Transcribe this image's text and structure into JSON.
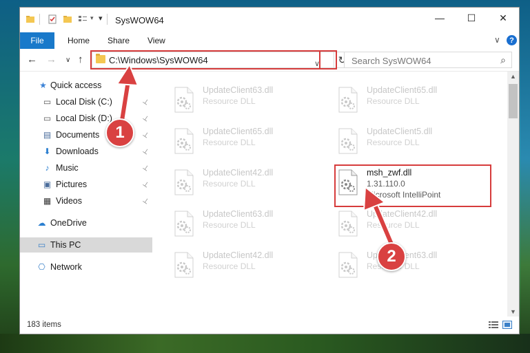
{
  "window": {
    "title": "SysWOW64",
    "minimize_glyph": "—",
    "maximize_glyph": "☐",
    "close_glyph": "✕"
  },
  "ribbon": {
    "tabs": [
      "File",
      "Home",
      "Share",
      "View"
    ],
    "expand_glyph": "∨",
    "help_glyph": "?"
  },
  "nav": {
    "back_glyph": "←",
    "forward_glyph": "→",
    "recent_glyph": "∨",
    "up_glyph": "↑",
    "address": "C:\\Windows\\SysWOW64",
    "address_dropdown_glyph": "∨",
    "refresh_glyph": "↻",
    "search_placeholder": "Search SysWOW64",
    "search_glyph": "⌕"
  },
  "sidebar": {
    "items": [
      {
        "label": "Quick access",
        "icon": "star-icon",
        "glyph": "★",
        "color": "#3b82d6",
        "pinned": false
      },
      {
        "label": "Local Disk (C:)",
        "icon": "drive-icon",
        "glyph": "▭",
        "color": "#555555",
        "pinned": true
      },
      {
        "label": "Local Disk (D:)",
        "icon": "drive-icon",
        "glyph": "▭",
        "color": "#555555",
        "pinned": true
      },
      {
        "label": "Documents",
        "icon": "documents-icon",
        "glyph": "▤",
        "color": "#4a6c9b",
        "pinned": true
      },
      {
        "label": "Downloads",
        "icon": "downloads-icon",
        "glyph": "⬇",
        "color": "#2b7fd0",
        "pinned": true
      },
      {
        "label": "Music",
        "icon": "music-icon",
        "glyph": "♪",
        "color": "#2b7fd0",
        "pinned": true
      },
      {
        "label": "Pictures",
        "icon": "pictures-icon",
        "glyph": "▣",
        "color": "#4a6c9b",
        "pinned": true
      },
      {
        "label": "Videos",
        "icon": "videos-icon",
        "glyph": "▦",
        "color": "#333333",
        "pinned": true
      },
      {
        "label": "OneDrive",
        "icon": "cloud-icon",
        "glyph": "☁",
        "color": "#2b7fd0",
        "pinned": false
      },
      {
        "label": "This PC",
        "icon": "computer-icon",
        "glyph": "▭",
        "color": "#3a80c8",
        "pinned": false
      },
      {
        "label": "Network",
        "icon": "network-icon",
        "glyph": "⎔",
        "color": "#3a80c8",
        "pinned": false
      }
    ],
    "pin_glyph": "📌"
  },
  "files": [
    {
      "name": "UpdateClient63.dll",
      "desc": "Resource DLL"
    },
    {
      "name": "UpdateClient65.dll",
      "desc": "Resource DLL"
    },
    {
      "name": "UpdateClient65.dll",
      "desc": "Resource DLL"
    },
    {
      "name": "UpdateClient5.dll",
      "desc": "Resource DLL"
    },
    {
      "name": "UpdateClient42.dll",
      "desc": "Resource DLL"
    },
    {
      "name": "msh_zwf.dll",
      "desc": "1.31.110.0",
      "desc2": "Microsoft IntelliPoint"
    },
    {
      "name": "UpdateClient63.dll",
      "desc": "Resource DLL"
    },
    {
      "name": "UpdateClient42.dll",
      "desc": "Resource DLL"
    },
    {
      "name": "UpdateClient42.dll",
      "desc": "Resource DLL"
    },
    {
      "name": "UpdateClient63.dll",
      "desc": "Resource DLL"
    }
  ],
  "status": {
    "item_count": "183 items"
  },
  "callouts": {
    "step1": "1",
    "step2": "2",
    "color": "#d94141"
  },
  "scrollbar": {
    "up_glyph": "▲",
    "down_glyph": "▼"
  }
}
